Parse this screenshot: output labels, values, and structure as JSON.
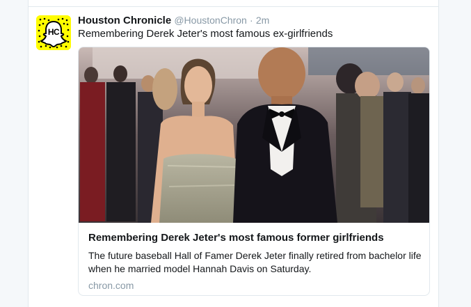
{
  "tweet": {
    "author_name": "Houston Chronicle",
    "author_handle": "@HoustonChron",
    "separator": "·",
    "time": "2m",
    "text": "Remembering Derek Jeter's most famous ex-girlfriends",
    "avatar_label": "HC",
    "avatar_color": "#fffc00"
  },
  "card": {
    "title": "Remembering Derek Jeter's most famous former girlfriends",
    "description": "The future baseball Hall of Famer Derek Jeter finally retired from bachelor life when he married model Hannah Davis on Saturday.",
    "domain": "chron.com"
  }
}
